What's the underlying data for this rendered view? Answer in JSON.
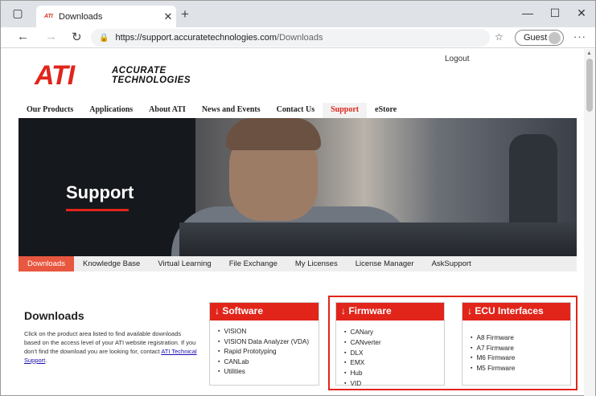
{
  "browser": {
    "tab_title": "Downloads",
    "tab_favicon": "ATI",
    "url_host": "https://support.accuratetechnologies.com",
    "url_path": "/Downloads",
    "profile_label": "Guest"
  },
  "header": {
    "logout": "Logout",
    "logo_mark": "ATI",
    "logo_line1": "ACCURATE",
    "logo_line2": "TECHNOLOGIES"
  },
  "topnav": {
    "items": [
      "Our Products",
      "Applications",
      "About ATI",
      "News and Events",
      "Contact Us",
      "Support",
      "eStore"
    ],
    "active": "Support"
  },
  "hero": {
    "title": "Support"
  },
  "subnav": {
    "items": [
      "Downloads",
      "Knowledge Base",
      "Virtual Learning",
      "File Exchange",
      "My Licenses",
      "License Manager",
      "AskSupport"
    ],
    "active": "Downloads"
  },
  "downloads": {
    "title": "Downloads",
    "description": "Click on the product area listed to find available downloads based on the access level of your ATI website registration. If you don't find the download you are looking for, contact ",
    "support_link": "ATI Technical Support",
    "description_end": "."
  },
  "cards": [
    {
      "title": "↓ Software",
      "items": [
        "VISION",
        "VISION Data Analyzer (VDA)",
        "Rapid Prototyping",
        "CANLab",
        "Utilities"
      ]
    },
    {
      "title": "↓ Firmware",
      "items": [
        "CANary",
        "CANverter",
        "DLX",
        "EMX",
        "Hub",
        "VID"
      ]
    },
    {
      "title": "↓ ECU Interfaces",
      "items": [
        "A8 Firmware",
        "A7 Firmware",
        "M6 Firmware",
        "M5 Firmware"
      ]
    }
  ],
  "colors": {
    "brand_red": "#e1251b",
    "subnav_active": "#e8573f"
  }
}
